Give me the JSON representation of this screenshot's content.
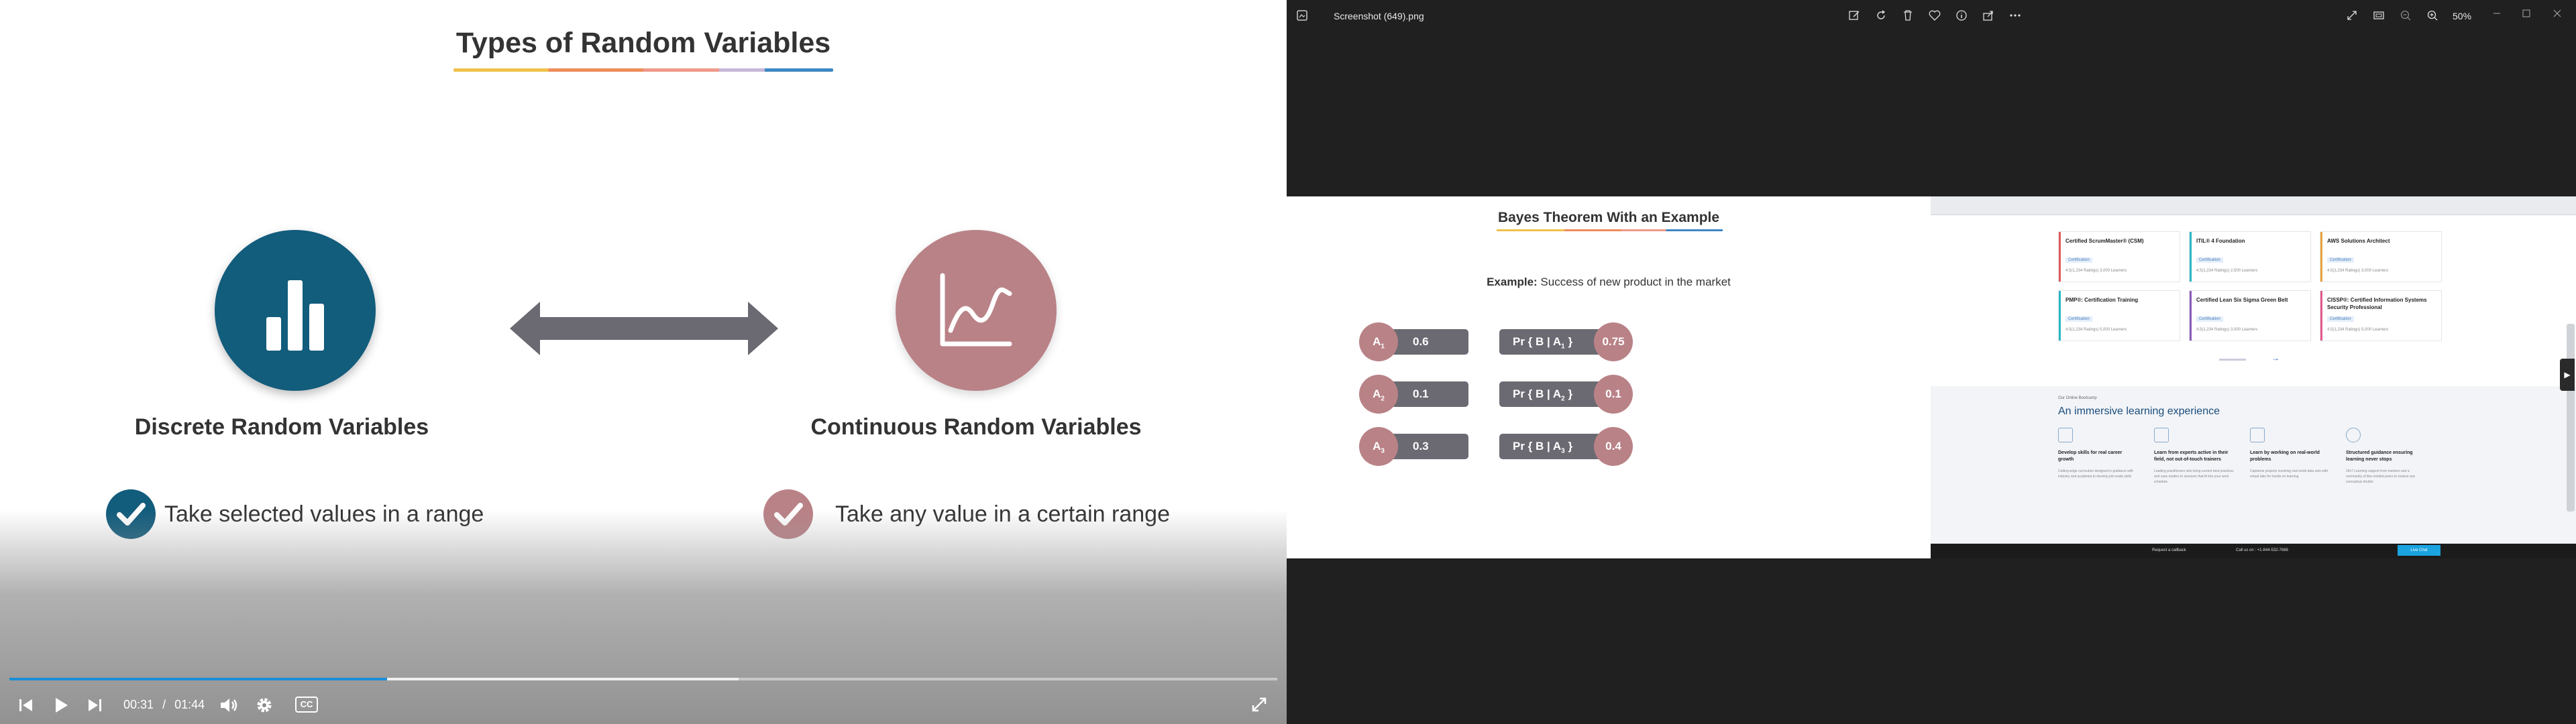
{
  "player": {
    "slide_title": "Types of Random Variables",
    "left_heading": "Discrete Random Variables",
    "right_heading": "Continuous Random Variables",
    "left_bullet": "Take selected values in a range",
    "right_bullet": "Take any value in a certain range",
    "current_time": "00:31",
    "separator": "/",
    "duration": "01:44",
    "progress": 0.298,
    "buffered": 0.575,
    "cc_label": "CC",
    "colors": {
      "discrete": "#125c7c",
      "continuous": "#b98287",
      "progress": "#1a8fd6"
    }
  },
  "viewer": {
    "file_name": "Screenshot (649).png",
    "zoom": "50%",
    "toolbar_icons": [
      "edit-icon",
      "rotate-icon",
      "delete-icon",
      "favorite-icon",
      "info-icon",
      "share-icon",
      "more-icon"
    ],
    "right_icons": [
      "fullscreen-icon",
      "slideshow-icon",
      "zoom-out-icon",
      "zoom-in-icon"
    ],
    "window_controls": [
      "minimize-icon",
      "maximize-icon",
      "close-icon"
    ]
  },
  "mini_slide": {
    "title": "Bayes Theorem With an Example",
    "example_label": "Example:",
    "example_text": " Success of new product in the market",
    "rows": [
      {
        "a_label": "A",
        "a_sub": "1",
        "a_value": "0.6",
        "pr_label": "Pr { B | A",
        "pr_sub": "1",
        "pr_close": " }",
        "pr_value": "0.75"
      },
      {
        "a_label": "A",
        "a_sub": "2",
        "a_value": "0.1",
        "pr_label": "Pr { B | A",
        "pr_sub": "2",
        "pr_close": " }",
        "pr_value": "0.1"
      },
      {
        "a_label": "A",
        "a_sub": "3",
        "a_value": "0.3",
        "pr_label": "Pr { B | A",
        "pr_sub": "3",
        "pr_close": " }",
        "pr_value": "0.4"
      }
    ]
  },
  "mini_site": {
    "courses": [
      {
        "title": "Certified ScrumMaster® (CSM)",
        "tag": "Certification",
        "meta": "4.5(1,234 Ratings)   3,000 Learners",
        "color": "#e25a5a"
      },
      {
        "title": "ITIL® 4 Foundation",
        "tag": "Certification",
        "meta": "4.5(1,234 Ratings)   2,500 Learners",
        "color": "#2bb7c4"
      },
      {
        "title": "AWS Solutions Architect",
        "tag": "Certification",
        "meta": "4.5(1,234 Ratings)   3,000 Learners",
        "color": "#e8a33c"
      },
      {
        "title": "PMP®: Certification Training",
        "tag": "Certification",
        "meta": "4.5(1,234 Ratings)   5,000 Learners",
        "color": "#2bb7c4"
      },
      {
        "title": "Certified Lean Six Sigma Green Belt",
        "tag": "Certification",
        "meta": "4.5(1,234 Ratings)   3,000 Learners",
        "color": "#8a5ab8"
      },
      {
        "title": "CISSP®: Certified Information Systems Security Professional",
        "tag": "Certification",
        "meta": "4.5(1,234 Ratings)   5,000 Learners",
        "color": "#e25a8a"
      }
    ],
    "section_kicker": "Our Online Bootcamp",
    "section_title": "An immersive learning experience",
    "features": [
      {
        "title": "Develop skills for real career growth",
        "desc": "Cutting-edge curriculum designed in guidance with industry and academia to develop job-ready skills"
      },
      {
        "title": "Learn from experts active in their field, not out-of-touch trainers",
        "desc": "Leading practitioners who bring current best practices and case studies to sessions that fit into your work schedule."
      },
      {
        "title": "Learn by working on real-world problems",
        "desc": "Capstone projects involving real world data sets with virtual labs for hands-on learning"
      },
      {
        "title": "Structured guidance ensuring learning never stops",
        "desc": "24x7 Learning support from mentors and a community of like-minded peers to resolve any conceptual doubts"
      }
    ],
    "footer_callback": "Request a callback",
    "footer_call": "Call us on : +1-844-532-7688",
    "footer_cta": "Live Chat"
  }
}
